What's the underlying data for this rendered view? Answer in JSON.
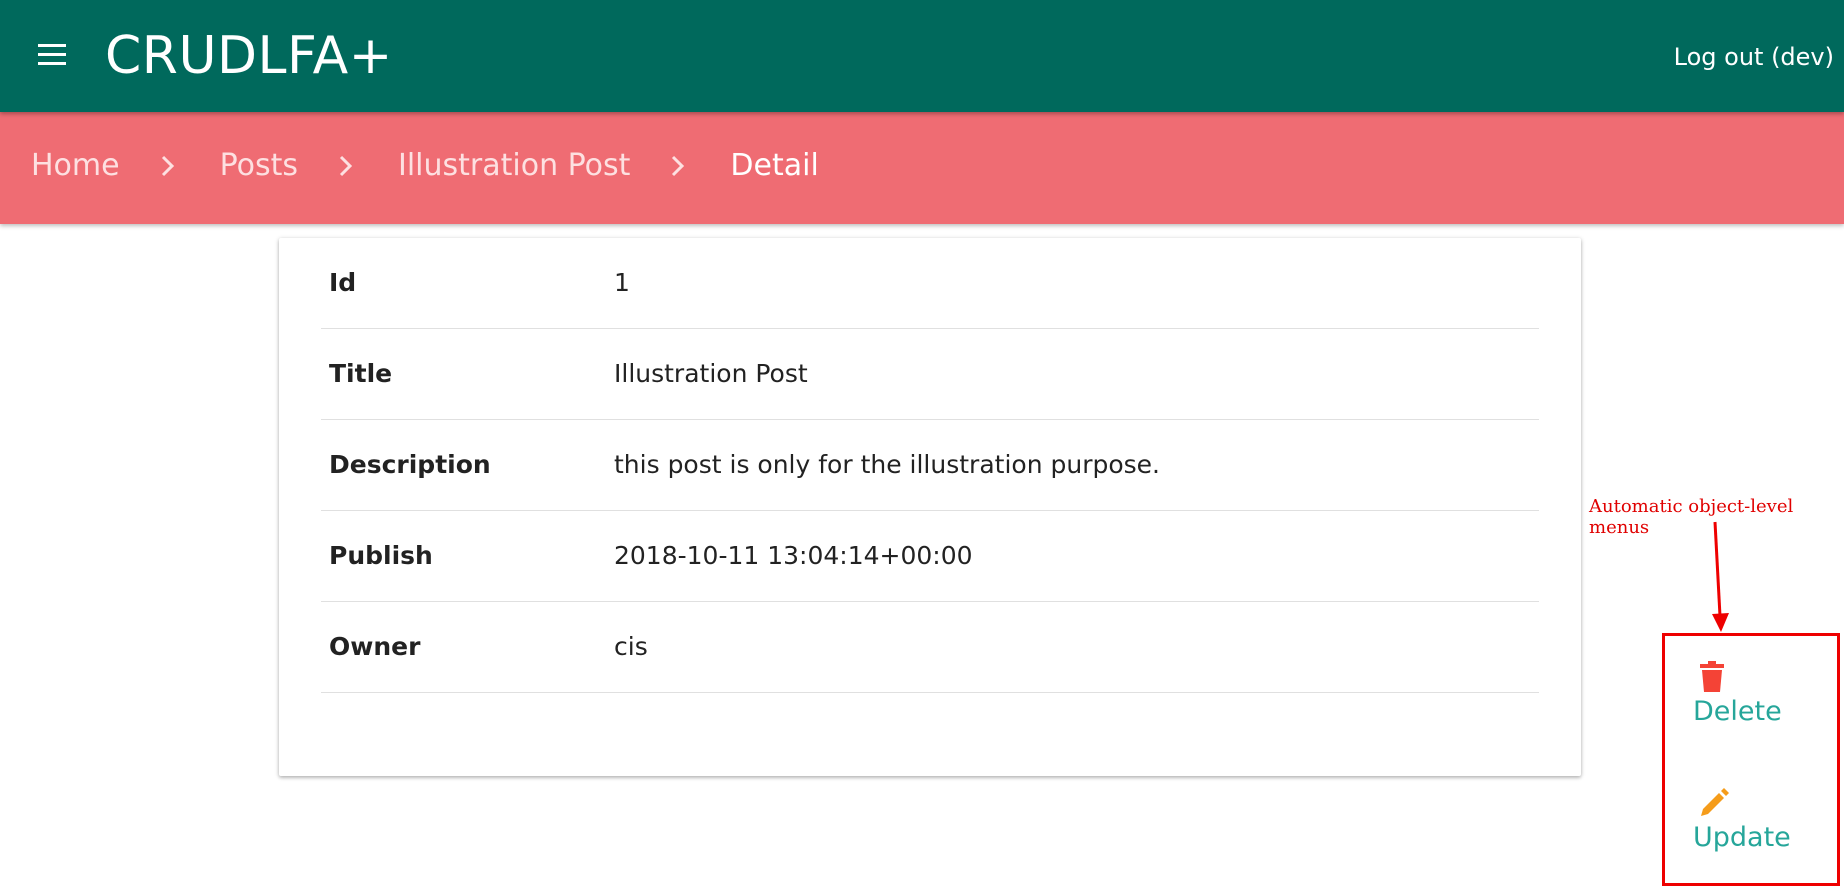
{
  "header": {
    "menu_icon": "hamburger-menu-icon",
    "title": "CRUDLFA+",
    "logout_label": "Log out (dev)"
  },
  "breadcrumb": {
    "items": [
      "Home",
      "Posts",
      "Illustration Post"
    ],
    "current": "Detail",
    "separator_icon": "chevron-right-icon"
  },
  "detail": {
    "rows": [
      {
        "label": "Id",
        "value": "1"
      },
      {
        "label": "Title",
        "value": "Illustration Post"
      },
      {
        "label": "Description",
        "value": "this post is only for the illustration purpose."
      },
      {
        "label": "Publish",
        "value": "2018-10-11 13:04:14+00:00"
      },
      {
        "label": "Owner",
        "value": "cis"
      }
    ]
  },
  "annotation": {
    "text": "Automatic object-level menus",
    "color": "#e00000"
  },
  "actions": {
    "delete": {
      "label": "Delete",
      "icon": "trash-icon",
      "icon_color": "#f44336"
    },
    "update": {
      "label": "Update",
      "icon": "pencil-icon",
      "icon_color": "#f59c1a"
    }
  },
  "colors": {
    "topbar": "#00695c",
    "breadcrumb_bar": "#ef6c73",
    "action_text": "#26a69a"
  }
}
